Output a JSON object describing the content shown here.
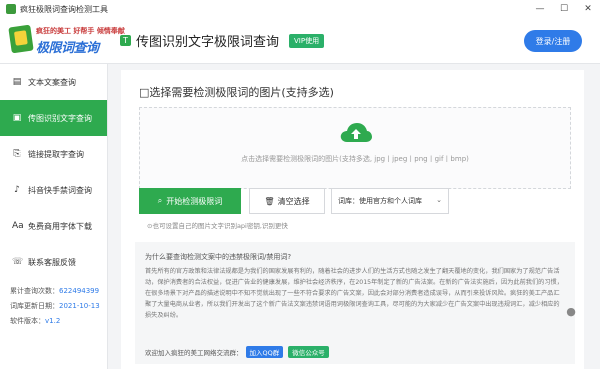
{
  "titlebar": {
    "title": "疯狂极限词查询检测工具",
    "minimize": "—",
    "maximize": "☐",
    "close": "✕"
  },
  "logo": {
    "sub": "疯狂的美工 好帮手 倾情奉献",
    "main": "极限词查询"
  },
  "header": {
    "page_icon": "T",
    "page_title": "传图识别文字极限词查询",
    "vip_badge": "VIP使用",
    "login_button": "登录/注册"
  },
  "sidebar": {
    "items": [
      {
        "icon": "▤",
        "label": "文本文案查询",
        "active": false
      },
      {
        "icon": "▣",
        "label": "传图识别文字查询",
        "active": true
      },
      {
        "icon": "⎘",
        "label": "链接提取字查询",
        "active": false
      },
      {
        "icon": "♪",
        "label": "抖音快手禁词查询",
        "active": false
      },
      {
        "icon": "Aa",
        "label": "免费商用字体下载",
        "active": false
      },
      {
        "icon": "☏",
        "label": "联系客服反馈",
        "active": false
      }
    ],
    "footer": {
      "query_count_label": "累计查询次数：",
      "query_count": "622494399",
      "lexicon_date_label": "词库更新日期：",
      "lexicon_date": "2021-10-13",
      "version_label": "软件版本：",
      "version": "v1.2"
    }
  },
  "main": {
    "section_title": "□选择需要检测极限词的图片(支持多选)",
    "dropzone_text": "点击选择需要检测极限词的图片(支持多选, jpg丨jpeg丨png丨gif丨bmp)",
    "start_button": "开始检测极限词",
    "clear_button": "清空选择",
    "lexicon_select": "词库：使用官方和个人词库",
    "hint": "⊙也可设置自己的图片文字识别api密钥,识别更快",
    "explain": {
      "question": "为什么要查询检测文案中的违禁极限词/禁用词?",
      "body": "首先所有的官方政策和法律法规都是为我们的国家发展有利的，随着社会的进步人们的生活方式也随之发生了翻天覆地的变化，我们国家为了规范广告活动，保护消费者的合法权益，促进广告业的健康发展，维护社会经济秩序，在2015年制定了新的广告法案。在新的广告法实施后，因为此前我们的习惯，在很多场景下对产品的描述说明中不知不觉就出现了一些不符合要求的广告文案，因此会对部分消费者造成误导，从而引来投诉风险。疯狂的美工产品汇聚了大量电商从业者，所以我们开发出了这个新广告法文案违禁词语用词极限词查询工具，尽可能的为大家减少在广告文案中出现违规词汇，减少相应的损失及纠纷。",
      "welcome": "欢迎加入疯狂的美工网络交流群：",
      "qq_chip": "加入QQ群",
      "wechat_chip": "微信公众号"
    }
  },
  "colors": {
    "accent_green": "#2eaa4f",
    "accent_blue": "#2f7be8"
  }
}
